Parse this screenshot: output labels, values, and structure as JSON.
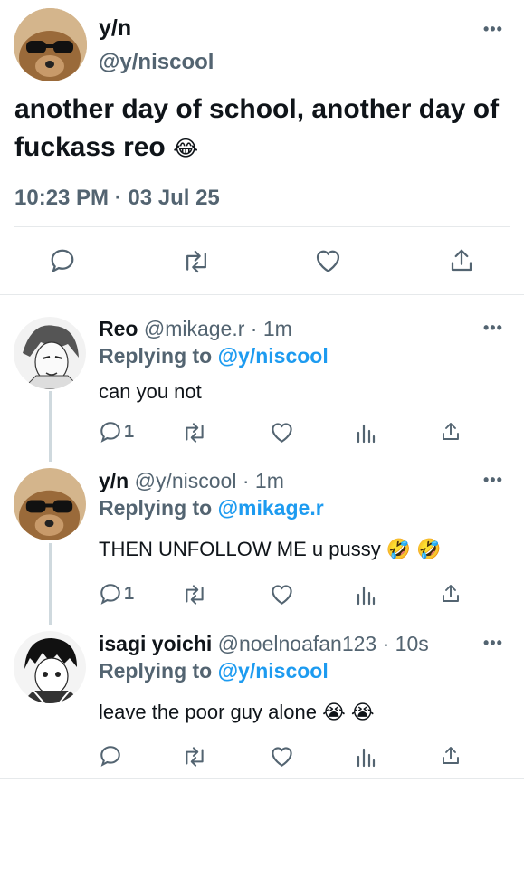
{
  "main_tweet": {
    "display_name": "y/n",
    "handle": "@y/niscool",
    "text": "another day of school, another day of fuckass reo",
    "text_emoji": "😂",
    "timestamp": "10:23 PM · 03 Jul 25",
    "more_glyph": "•••",
    "actions": [
      "reply-icon",
      "retweet-icon",
      "like-icon",
      "share-icon"
    ]
  },
  "replies": [
    {
      "display_name": "Reo",
      "handle_time": "@mikage.r · 1m",
      "replying_prefix": "Replying to",
      "replying_to": "@y/niscool",
      "text": "can you not",
      "reply_count": "1",
      "more_glyph": "•••"
    },
    {
      "display_name": "y/n",
      "handle_time": "@y/niscool · 1m",
      "replying_prefix": "Replying to",
      "replying_to": "@mikage.r",
      "text": "THEN UNFOLLOW ME u pussy",
      "text_emoji": "🤣 🤣",
      "reply_count": "1",
      "more_glyph": "•••"
    },
    {
      "display_name": "isagi yoichi",
      "handle_time": "@noelnoafan123 · 10s",
      "replying_prefix": "Replying to",
      "replying_to": "@y/niscool",
      "text": "leave the poor guy alone",
      "text_emoji": "😭 😭",
      "more_glyph": "•••"
    }
  ],
  "colors": {
    "text": "#0f1419",
    "secondary": "#536471",
    "link": "#1d9bf0",
    "divider": "#e6e9eb"
  }
}
